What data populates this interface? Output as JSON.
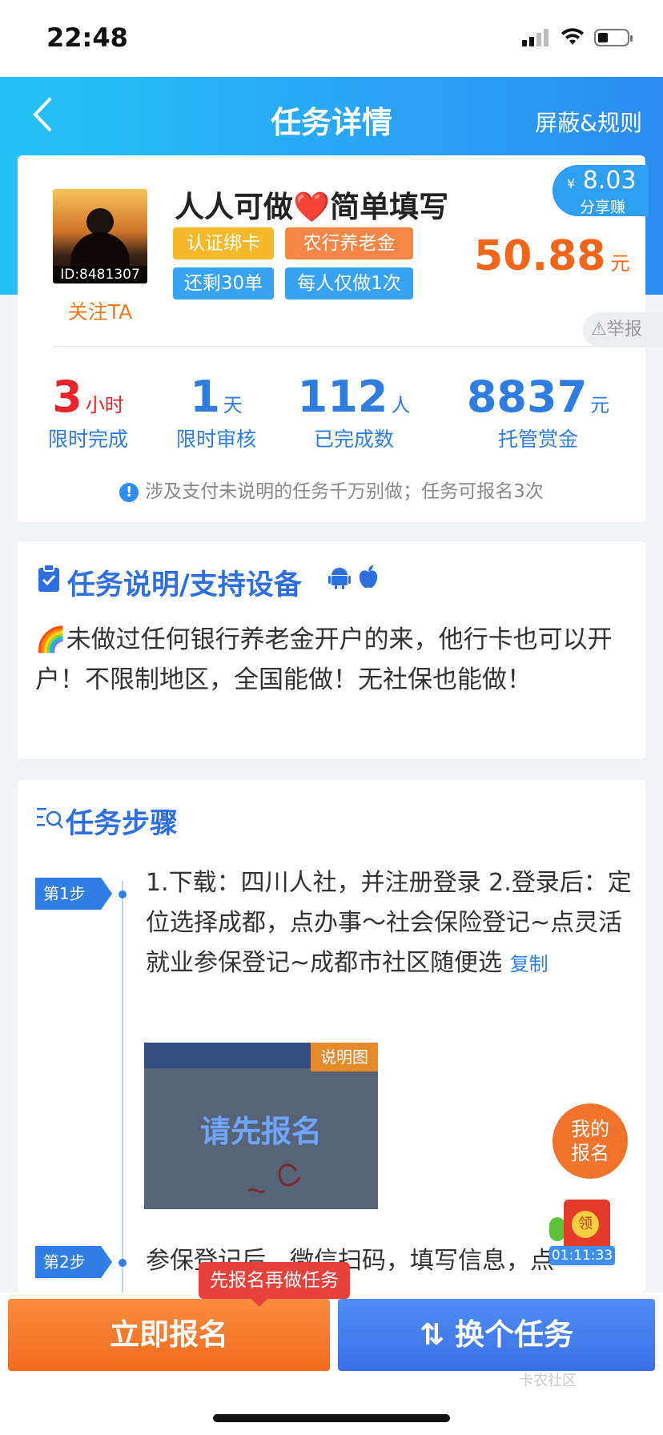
{
  "status": {
    "time": "22:48"
  },
  "header": {
    "title": "任务详情",
    "rules": "屏蔽&规则"
  },
  "task": {
    "avatar_id": "ID:8481307",
    "follow": "关注TA",
    "title": "人人可做❤️简单填写",
    "tags": [
      "认证绑卡",
      "农行养老金",
      "还剩30单",
      "每人仅做1次"
    ],
    "price": "50.88",
    "price_unit": "元",
    "share": {
      "currency": "¥",
      "amount": "8.03",
      "label": "分享赚"
    },
    "report": "举报",
    "stats": [
      {
        "num": "3",
        "unit": "小时",
        "label": "限时完成",
        "color": "#e8242a"
      },
      {
        "num": "1",
        "unit": "天",
        "label": "限时审核",
        "color": "#2f7de1"
      },
      {
        "num": "112",
        "unit": "人",
        "label": "已完成数",
        "color": "#2f7de1"
      },
      {
        "num": "8837",
        "unit": "元",
        "label": "托管赏金",
        "color": "#2f7de1"
      }
    ],
    "notice": "涉及支付未说明的任务千万别做；任务可报名3次"
  },
  "description": {
    "title": "任务说明/支持设备",
    "text": "🌈未做过任何银行养老金开户的来，他行卡也可以开户！不限制地区，全国能做！无社保也能做！"
  },
  "steps": {
    "title": "任务步骤",
    "items": [
      {
        "badge": "第1步",
        "text": "1.下载：四川人社，并注册登录 2.登录后：定位选择成都，点办事～社会保险登记~点灵活就业参保登记~成都市社区随便选",
        "copy": "复制",
        "image_tag": "说明图",
        "image_overlay": "请先报名"
      },
      {
        "badge": "第2步",
        "text": "参保登记后，微信扫码，填写信息，点"
      }
    ]
  },
  "floating": {
    "mine_line1": "我的",
    "mine_line2": "报名",
    "redpacket_label": "领",
    "timer": "01:11:33"
  },
  "bottom": {
    "tip": "先报名再做任务",
    "apply": "立即报名",
    "switch": "换个任务",
    "watermark": "卡农社区"
  }
}
